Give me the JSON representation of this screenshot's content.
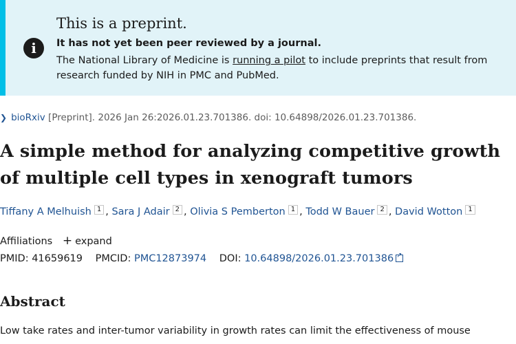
{
  "banner": {
    "heading": "This is a preprint.",
    "subheading": "It has not yet been peer reviewed by a journal.",
    "body_before": "The National Library of Medicine is ",
    "body_link": "running a pilot",
    "body_after": " to include preprints that result from research funded by NIH in PMC and PubMed.",
    "icon": "info-icon"
  },
  "citation": {
    "source": "bioRxiv",
    "text": " [Preprint]. 2026 Jan 26:2026.01.23.701386. doi: 10.64898/2026.01.23.701386."
  },
  "article": {
    "title": "A simple method for analyzing competitive growth of multiple cell types in xenograft tumors"
  },
  "authors": [
    {
      "name": "Tiffany A Melhuish",
      "aff": "1"
    },
    {
      "name": "Sara J Adair",
      "aff": "2"
    },
    {
      "name": "Olivia S Pemberton",
      "aff": "1"
    },
    {
      "name": "Todd W Bauer",
      "aff": "2"
    },
    {
      "name": "David Wotton",
      "aff": "1"
    }
  ],
  "affiliations": {
    "label": "Affiliations",
    "expand": "expand"
  },
  "ids": {
    "pmid_label": "PMID:",
    "pmid": "41659619",
    "pmcid_label": "PMCID:",
    "pmcid": "PMC12873974",
    "doi_label": "DOI:",
    "doi": "10.64898/2026.01.23.701386"
  },
  "abstract": {
    "heading": "Abstract",
    "text": "Low take rates and inter-tumor variability in growth rates can limit the effectiveness of mouse"
  }
}
